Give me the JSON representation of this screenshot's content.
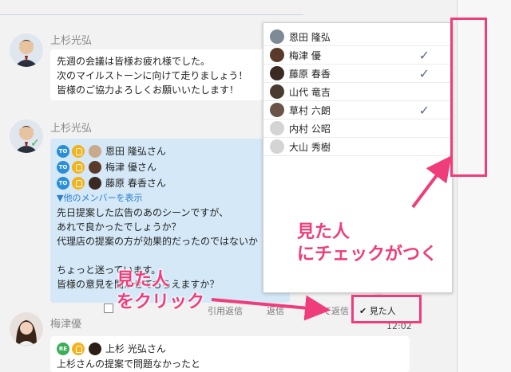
{
  "messages": [
    {
      "sender": "上杉光弘",
      "lines": [
        "先週の会議は皆様お疲れ様でした。",
        "次のマイルストーンに向けて走りましょう！",
        "皆様のご協力よろしくお願いいたします！"
      ]
    },
    {
      "sender": "上杉光弘",
      "to": [
        {
          "badge": "TO",
          "name": "恩田 隆弘さん"
        },
        {
          "badge": "TO",
          "name": "梅津 優さん"
        },
        {
          "badge": "TO",
          "name": "藤原 春香さん"
        }
      ],
      "more_members": "▼他のメンバーを表示",
      "lines": [
        "先日提案した広告のあのシーンですが、",
        "あれで良かったでしょうか？",
        "代理店の提案の方が効果的だったのではないか",
        "",
        "ちょっと迷っています。",
        "皆様の意見を聞かせてもらえますか？"
      ]
    },
    {
      "sender": "梅津優",
      "reply": {
        "badge": "RE",
        "name": "上杉 光弘さん"
      },
      "lines": [
        "上杉さんの提案で問題なかったと"
      ]
    }
  ],
  "toolbar": {
    "quote": "引用返信",
    "reply": "返信",
    "chat_reply": "で返信",
    "seen": "見た人",
    "time": "12:02"
  },
  "seen_popup": {
    "members": [
      {
        "name": "恩田 隆弘",
        "checked": false
      },
      {
        "name": "梅津 優",
        "checked": true
      },
      {
        "name": "藤原 春香",
        "checked": true
      },
      {
        "name": "山代 竜吉",
        "checked": false
      },
      {
        "name": "草村 六朗",
        "checked": true
      },
      {
        "name": "内村 公昭",
        "checked": false
      },
      {
        "name": "大山 秀樹",
        "checked": false
      }
    ],
    "check_mark": "✓"
  },
  "annotations": {
    "click_seen_line1": "見た人",
    "click_seen_line2": "をクリック",
    "check_line1": "見た人",
    "check_line2": "にチェックがつく"
  },
  "colors": {
    "accent": "#ef3d7b",
    "to_badge": "#2a8fd6",
    "re_badge": "#3cae5c",
    "bell": "#f4b21c",
    "blue_bubble": "#d4e8f7"
  }
}
